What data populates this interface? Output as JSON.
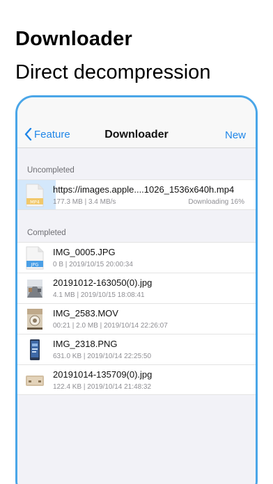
{
  "promo": {
    "title": "Downloader",
    "subtitle": "Direct decompression"
  },
  "navbar": {
    "back_label": "Feature",
    "title": "Downloader",
    "action_label": "New"
  },
  "sections": {
    "uncompleted_header": "Uncompleted",
    "completed_header": "Completed"
  },
  "uncompleted": [
    {
      "name": "https://images.apple....1026_1536x640h.mp4",
      "meta": "177.3 MB | 3.4 MB/s",
      "status": "Downloading 16%",
      "progress": 0.16,
      "icon": "mp4-file-icon",
      "badge": "MP4"
    }
  ],
  "completed": [
    {
      "name": "IMG_0005.JPG",
      "meta": "0 B | 2019/10/15 20:00:34",
      "icon": "jpg-file-icon",
      "badge": "JPG"
    },
    {
      "name": "20191012-163050(0).jpg",
      "meta": "4.1 MB | 2019/10/15 18:08:41",
      "icon": "photo-thumbnail-road"
    },
    {
      "name": "IMG_2583.MOV",
      "meta": "00:21 | 2.0 MB | 2019/10/14 22:26:07",
      "icon": "video-thumbnail"
    },
    {
      "name": "IMG_2318.PNG",
      "meta": "631.0 KB | 2019/10/14 22:25:50",
      "icon": "phone-screenshot-thumbnail"
    },
    {
      "name": "20191014-135709(0).jpg",
      "meta": "122.4 KB | 2019/10/14 21:48:32",
      "icon": "photo-thumbnail-box"
    }
  ],
  "colors": {
    "accent": "#1f86e8",
    "frame": "#4aa6e8",
    "progress": "#d4e8fb",
    "badge": "#4a9fe6",
    "mp4_badge": "#f1c86a"
  }
}
